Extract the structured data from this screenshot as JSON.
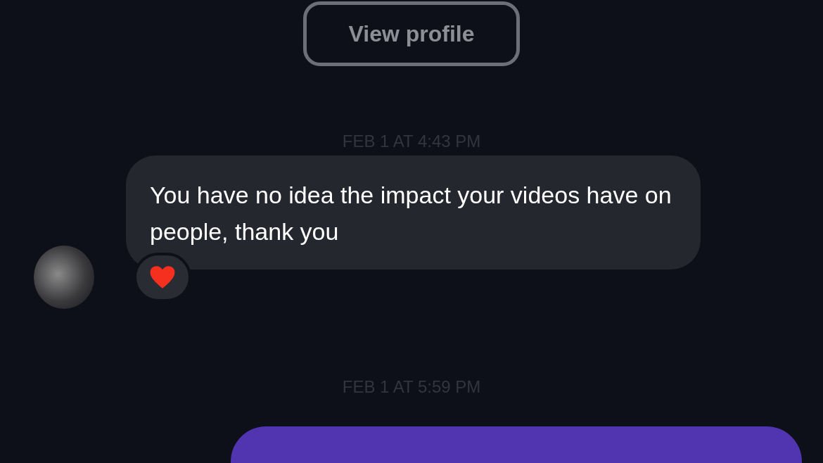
{
  "profile_button": {
    "label": "View profile"
  },
  "messages": [
    {
      "kind": "timestamp",
      "text": "FEB 1 AT 4:43 PM"
    },
    {
      "kind": "incoming",
      "text": "You have no idea the impact your videos have on people, thank you",
      "reacted": true
    },
    {
      "kind": "timestamp",
      "text": "FEB 1 AT 5:59 PM"
    },
    {
      "kind": "outgoing"
    }
  ]
}
